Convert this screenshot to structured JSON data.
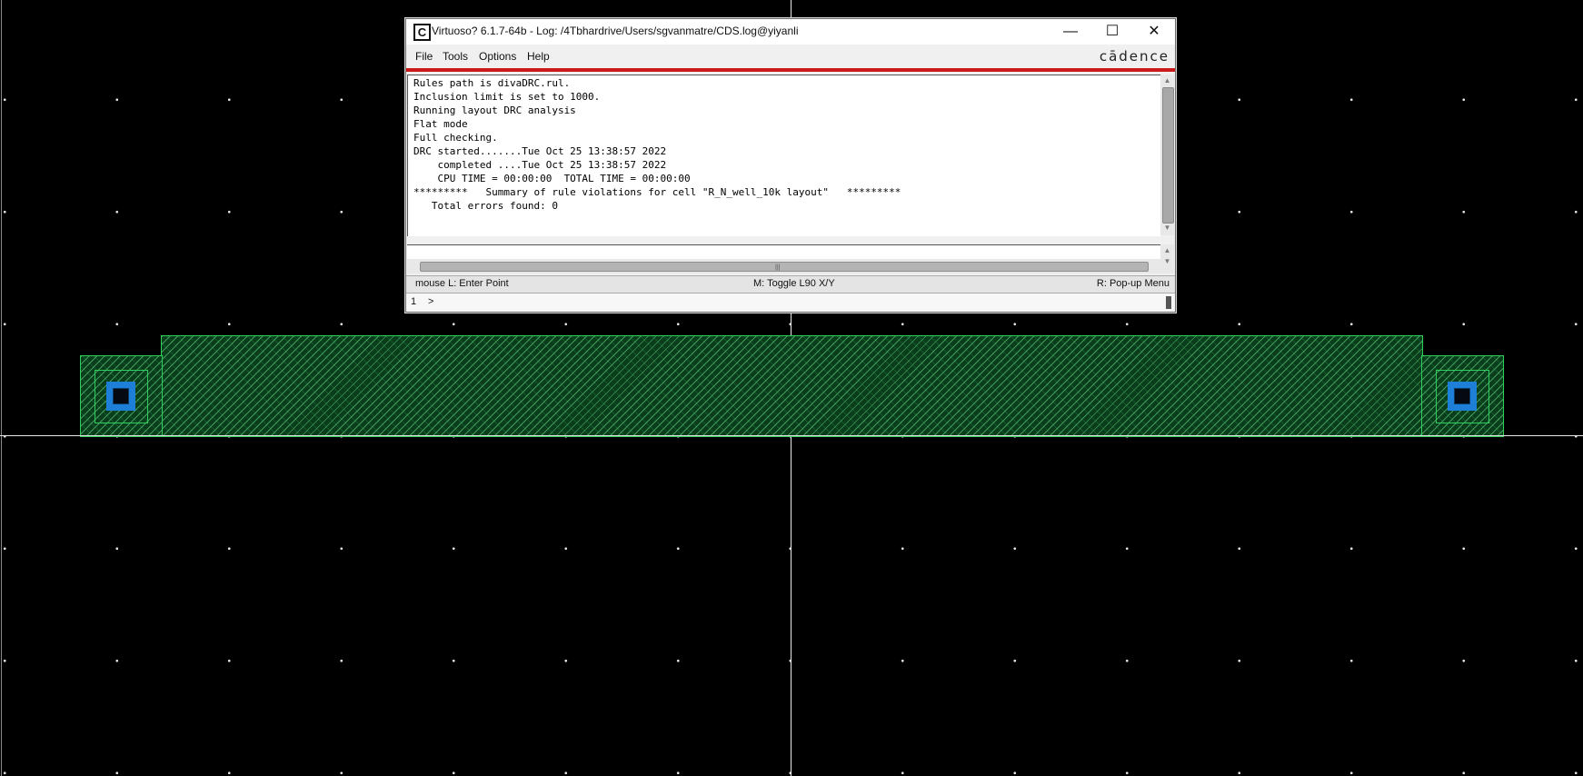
{
  "window": {
    "icon": "cadence-c-icon",
    "icon_glyph": "C",
    "title": "Virtuoso? 6.1.7-64b - Log: /4Tbhardrive/Users/sgvanmatre/CDS.log@yiyanli",
    "controls": {
      "minimize": "—",
      "maximize": "☐",
      "close": "✕"
    }
  },
  "menu": {
    "items": [
      "File",
      "Tools",
      "Options",
      "Help"
    ],
    "brand": "cādence"
  },
  "log": {
    "lines": [
      "Rules path is divaDRC.rul.",
      "Inclusion limit is set to 1000.",
      "Running layout DRC analysis",
      "Flat mode",
      "Full checking.",
      "DRC started.......Tue Oct 25 13:38:57 2022",
      "    completed ....Tue Oct 25 13:38:57 2022",
      "    CPU TIME = 00:00:00  TOTAL TIME = 00:00:00",
      "*********   Summary of rule violations for cell \"R_N_well_10k layout\"   *********",
      "   Total errors found: 0"
    ]
  },
  "status": {
    "left": "mouse L: Enter Point",
    "middle": "M: Toggle L90 X/Y",
    "right": "R: Pop-up Menu"
  },
  "command": {
    "line_number": "1",
    "prompt": ">"
  },
  "colors": {
    "canvas": "#000000",
    "nwell": "#2ecf5c",
    "contact": "#1e7fd8",
    "accent_red": "#cc1a1a"
  }
}
